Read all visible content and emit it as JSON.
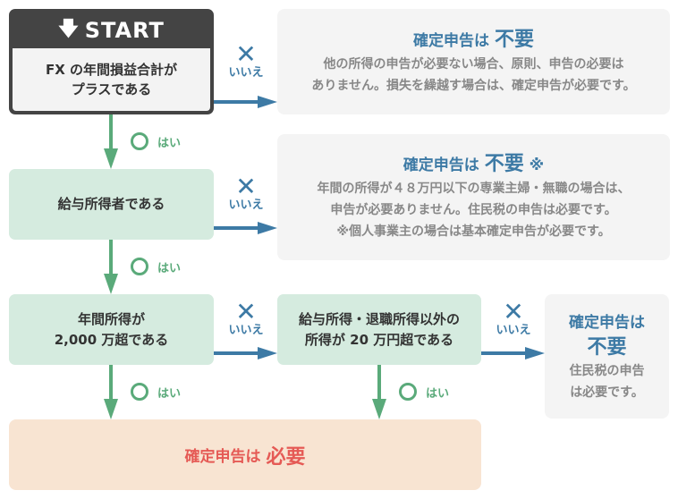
{
  "colors": {
    "start_dark": "#444444",
    "green_box": "#d5ebdf",
    "gray_box": "#f4f4f4",
    "orange_box": "#f8e4d2",
    "yes_green": "#5aaa7a",
    "no_blue": "#3d7aa5",
    "required_red": "#e55a55"
  },
  "start": {
    "icon": "down-arrow-icon",
    "label": "START",
    "question_line1": "FX の年間損益合計が",
    "question_line2": "プラスである"
  },
  "questions": [
    {
      "id": "salaried",
      "line1": "給与所得者である"
    },
    {
      "id": "income-20m",
      "line1": "年間所得が",
      "line2": "2,000 万超である"
    },
    {
      "id": "other-income-200k",
      "line1": "給与所得・退職所得以外の",
      "line2": "所得が 20 万円超である"
    }
  ],
  "labels": {
    "yes_icon": "circle-icon",
    "yes": "はい",
    "no_icon": "cross-icon",
    "no_glyph": "✕",
    "no": "いいえ"
  },
  "results": {
    "not_required_1": {
      "title": "確定申告は",
      "emphasis": "不要",
      "desc_line1": "他の所得の申告が必要ない場合、原則、申告の必要は",
      "desc_line2": "ありません。損失を繰越す場合は、確定申告が必要です。"
    },
    "not_required_2": {
      "title": "確定申告は",
      "emphasis": "不要",
      "note_mark": "※",
      "desc_line1": "年間の所得が４８万円以下の専業主婦・無職の場合は、",
      "desc_line2": "申告が必要ありません。住民税の申告は必要です。",
      "desc_line3": "※個人事業主の場合は基本確定申告が必要です。"
    },
    "not_required_3": {
      "title": "確定申告は",
      "emphasis": "不要",
      "desc_line1": "住民税の申告",
      "desc_line2": "は必要です。"
    },
    "required": {
      "title": "確定申告は",
      "emphasis": "必要"
    }
  }
}
